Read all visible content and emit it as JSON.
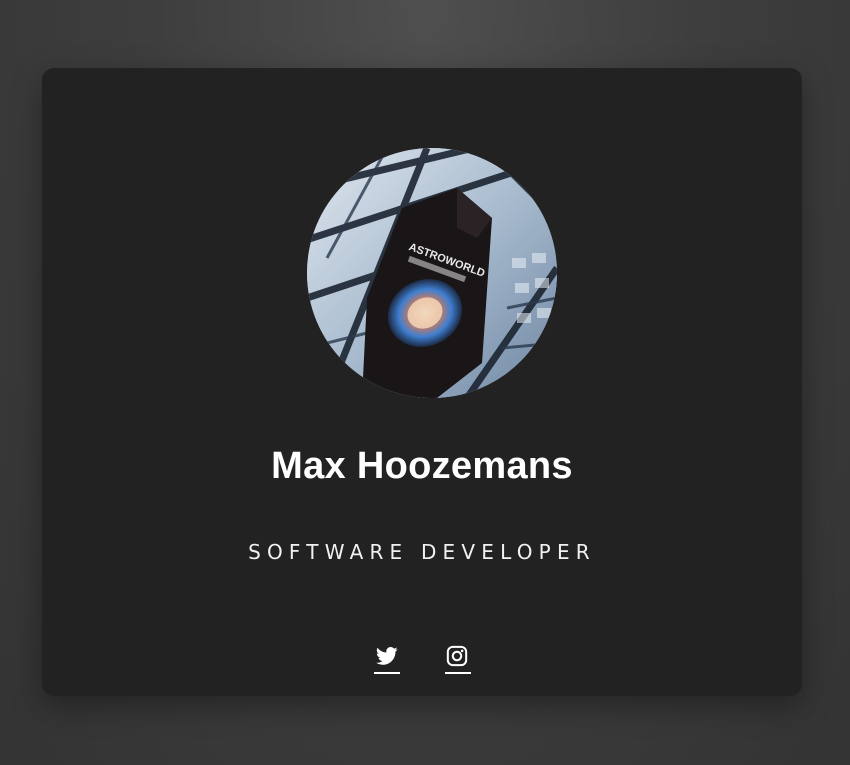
{
  "profile": {
    "name": "Max Hoozemans",
    "role": "SOFTWARE DEVELOPER",
    "avatar_alt": "Profile photo",
    "shirt_print": "ASTROWORLD"
  },
  "socials": [
    {
      "network": "Twitter",
      "icon": "twitter-icon"
    },
    {
      "network": "Instagram",
      "icon": "instagram-icon"
    }
  ],
  "colors": {
    "background": "#3e3e3e",
    "card": "#222222",
    "text": "#ffffff"
  }
}
